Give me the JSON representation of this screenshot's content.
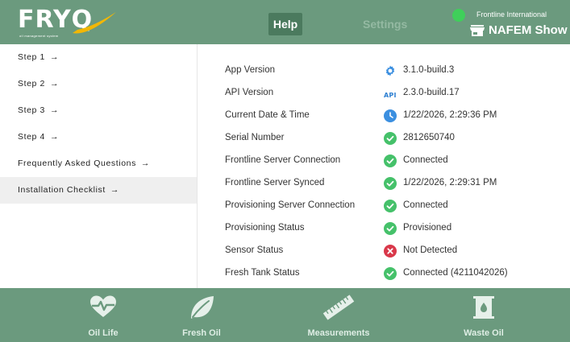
{
  "header": {
    "logo_text": "FRYQ",
    "logo_subtitle": "oil management system",
    "tabs": [
      {
        "label": "Help",
        "active": true
      },
      {
        "label": "Settings",
        "active": false
      }
    ],
    "company": "Frontline International",
    "show_name": "NAFEM Show",
    "status_color": "#3fcf5a"
  },
  "sidebar": {
    "items": [
      {
        "label": "Step 1",
        "arrow": "→",
        "active": false
      },
      {
        "label": "Step 2",
        "arrow": "→",
        "active": false
      },
      {
        "label": "Step 3",
        "arrow": "→",
        "active": false
      },
      {
        "label": "Step 4",
        "arrow": "→",
        "active": false
      },
      {
        "label": "Frequently Asked Questions",
        "arrow": "→",
        "active": false
      },
      {
        "label": "Installation Checklist",
        "arrow": "→",
        "active": true
      }
    ]
  },
  "info": {
    "rows": [
      {
        "label": "App Version",
        "icon": "gear-icon",
        "value": "3.1.0-build.3"
      },
      {
        "label": "API Version",
        "icon": "api-icon",
        "icon_text": "API",
        "value": "2.3.0-build.17"
      },
      {
        "label": "Current Date & Time",
        "icon": "clock-icon",
        "value": "1/22/2026, 2:29:36 PM"
      },
      {
        "label": "Serial Number",
        "icon": "check-circle-icon",
        "value": "2812650740"
      },
      {
        "label": "Frontline Server Connection",
        "icon": "check-circle-icon",
        "value": "Connected"
      },
      {
        "label": "Frontline Server Synced",
        "icon": "check-circle-icon",
        "value": "1/22/2026, 2:29:31 PM"
      },
      {
        "label": "Provisioning Server Connection",
        "icon": "check-circle-icon",
        "value": "Connected"
      },
      {
        "label": "Provisioning Status",
        "icon": "check-circle-icon",
        "value": "Provisioned"
      },
      {
        "label": "Sensor Status",
        "icon": "error-circle-icon",
        "value": "Not Detected"
      },
      {
        "label": "Fresh Tank Status",
        "icon": "check-circle-icon",
        "value": "Connected (4211042026)"
      }
    ]
  },
  "bottom_nav": {
    "items": [
      {
        "label": "Oil Life",
        "icon": "heart-pulse-icon"
      },
      {
        "label": "Fresh Oil",
        "icon": "leaf-icon"
      },
      {
        "label": "Measurements",
        "icon": "ruler-icon"
      },
      {
        "label": "Waste Oil",
        "icon": "oil-barrel-icon"
      }
    ]
  },
  "colors": {
    "brand_green": "#6b9a7e",
    "active_tab": "#4b7a5e",
    "ok": "#45c16a",
    "error": "#d9384a",
    "info_blue": "#3b8fe0"
  }
}
